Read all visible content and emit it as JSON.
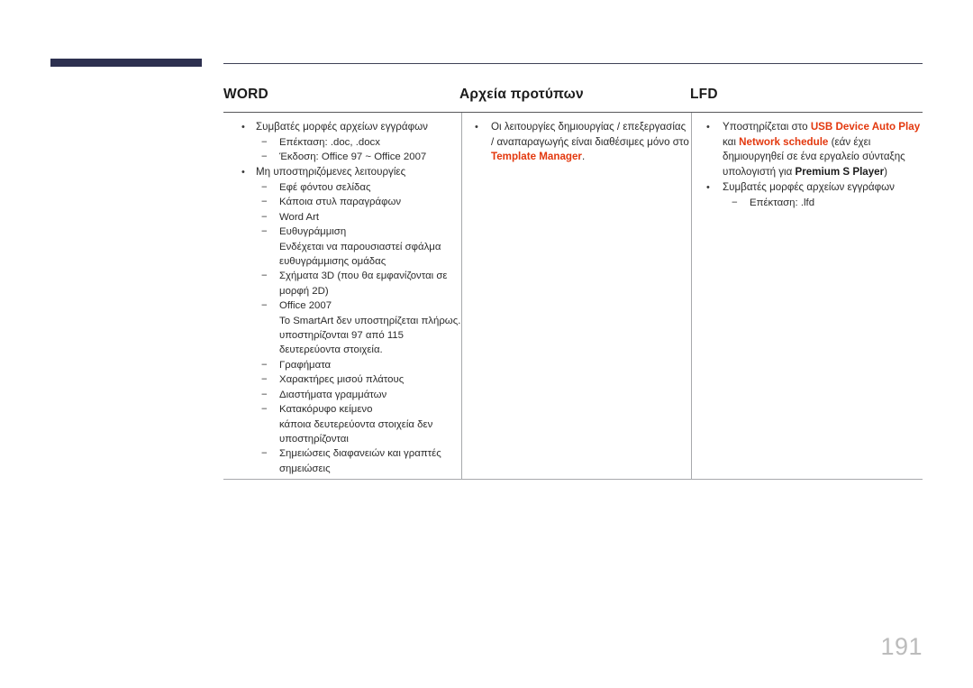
{
  "page": {
    "number": "191",
    "accent_bar_color": "#2d3050",
    "highlight_color": "#e3380e",
    "rule_color": "#58585b"
  },
  "columns": [
    {
      "id": "word",
      "title": "WORD"
    },
    {
      "id": "templates",
      "title": "Αρχεία προτύπων"
    },
    {
      "id": "lfd",
      "title": "LFD"
    }
  ],
  "word_column": {
    "groups": [
      {
        "bullet": "•",
        "label": "Συμβατές μορφές αρχείων εγγράφων",
        "items": [
          {
            "mark": "−",
            "label": "Επέκταση: .doc, .docx",
            "note": ""
          },
          {
            "mark": "−",
            "label": "Έκδοση: Office 97 ~ Office 2007",
            "note": ""
          }
        ]
      },
      {
        "bullet": "•",
        "label": "Μη υποστηριζόμενες λειτουργίες",
        "items": [
          {
            "mark": "−",
            "label": "Εφέ φόντου σελίδας",
            "note": ""
          },
          {
            "mark": "−",
            "label": "Κάποια στυλ παραγράφων",
            "note": ""
          },
          {
            "mark": "−",
            "label": "Word Art",
            "note": ""
          },
          {
            "mark": "−",
            "label": "Ευθυγράμμιση",
            "note": "Ενδέχεται να παρουσιαστεί σφάλμα ευθυγράμμισης ομάδας"
          },
          {
            "mark": "−",
            "label": "Σχήματα 3D (που θα εμφανίζονται σε μορφή 2D)",
            "note": ""
          },
          {
            "mark": "−",
            "label": "Office 2007",
            "note": "Το SmartArt δεν υποστηρίζεται πλήρως. υποστηρίζονται 97 από 115 δευτερεύοντα στοιχεία."
          },
          {
            "mark": "−",
            "label": "Γραφήματα",
            "note": ""
          },
          {
            "mark": "−",
            "label": "Χαρακτήρες μισού πλάτους",
            "note": ""
          },
          {
            "mark": "−",
            "label": "Διαστήματα γραμμάτων",
            "note": ""
          },
          {
            "mark": "−",
            "label": "Κατακόρυφο κείμενο",
            "note": "κάποια δευτερεύοντα στοιχεία δεν υποστηρίζονται"
          },
          {
            "mark": "−",
            "label": "Σημειώσεις διαφανειών και γραπτές σημειώσεις",
            "note": ""
          }
        ]
      }
    ]
  },
  "templates_column": {
    "bullet": "•",
    "text_before": "Οι λειτουργίες δημιουργίας / επεξεργασίας / αναπαραγωγής είναι διαθέσιμες μόνο στο ",
    "highlight": "Template Manager",
    "text_after": "."
  },
  "lfd_column": {
    "bullet_1": "•",
    "support_prefix": "Υποστηρίζεται στο ",
    "support_hl1": "USB Device Auto Play",
    "support_mid": " και ",
    "support_hl2": "Network schedule",
    "support_paren_open": " (εάν έχει δημιουργηθεί σε ένα εργαλείο σύνταξης υπολογιστή για ",
    "support_bold": "Premium S Player",
    "support_paren_close": ")",
    "bullet_2": "•",
    "formats_label": "Συμβατές μορφές αρχείων εγγράφων",
    "formats_item_mark": "−",
    "formats_item": "Επέκταση: .lfd"
  }
}
